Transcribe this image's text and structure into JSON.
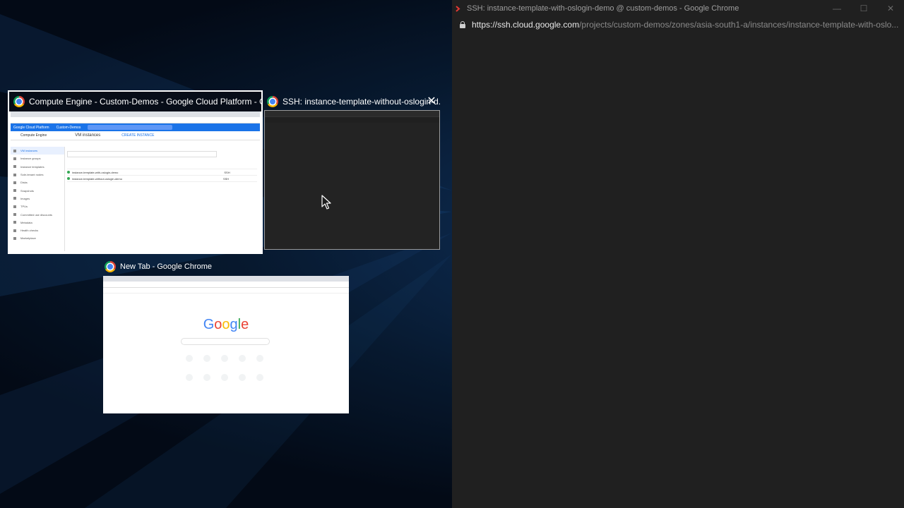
{
  "snap_assist": {
    "windows": [
      {
        "title": "Compute Engine - Custom-Demos - Google Cloud Platform - Goo...",
        "icon": "chrome-icon"
      },
      {
        "title": "SSH: instance-template-without-oslogin-d...",
        "icon": "chrome-icon",
        "close_glyph": "✕"
      },
      {
        "title": "New Tab - Google Chrome",
        "icon": "chrome-icon"
      }
    ]
  },
  "gcp_thumbnail": {
    "brand": "Google Cloud Platform",
    "project": "Custom-Demos",
    "product": "Compute Engine",
    "page": "VM instances",
    "create": "CREATE INSTANCE",
    "nav": [
      "VM instances",
      "Instance groups",
      "Instance templates",
      "Sole-tenant nodes",
      "Disks",
      "Snapshots",
      "Images",
      "TPUs",
      "Committed use discounts",
      "Metadata",
      "Health checks",
      "Marketplace"
    ],
    "rows": [
      {
        "name": "instance-template-with-oslogin-demo",
        "ssh": "SSH"
      },
      {
        "name": "instance-template-without-oslogin-demo",
        "ssh": "SSH"
      }
    ]
  },
  "newtab_thumbnail": {
    "logo_letters": [
      {
        "ch": "G",
        "color": "#4285F4"
      },
      {
        "ch": "o",
        "color": "#EA4335"
      },
      {
        "ch": "o",
        "color": "#FBBC05"
      },
      {
        "ch": "g",
        "color": "#4285F4"
      },
      {
        "ch": "l",
        "color": "#34A853"
      },
      {
        "ch": "e",
        "color": "#EA4335"
      }
    ]
  },
  "ssh_window": {
    "title": "SSH: instance-template-with-oslogin-demo @ custom-demos - Google Chrome",
    "url_host": "https://ssh.cloud.google.com",
    "url_path": "/projects/custom-demos/zones/asia-south1-a/instances/instance-template-with-oslo...",
    "controls": {
      "minimize": "—",
      "maximize": "☐",
      "close": "✕"
    }
  }
}
